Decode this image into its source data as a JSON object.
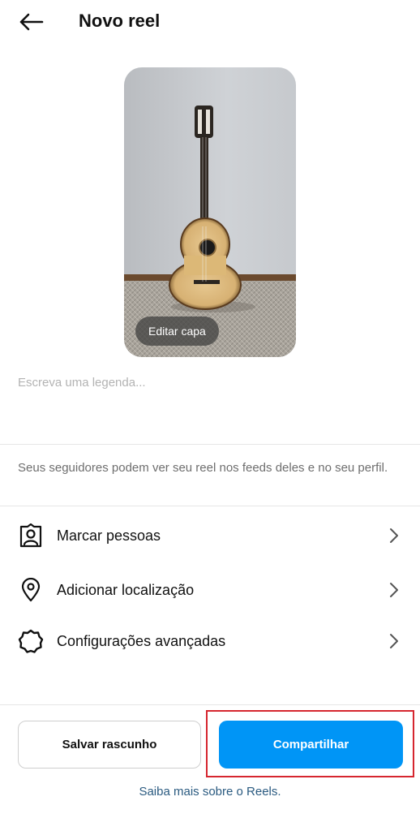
{
  "header": {
    "title": "Novo reel",
    "back_icon": "arrow-left-icon"
  },
  "cover": {
    "edit_label": "Editar capa"
  },
  "caption": {
    "placeholder": "Escreva uma legenda...",
    "value": ""
  },
  "info_text": "Seus seguidores podem ver seu reel nos feeds deles e no seu perfil.",
  "menu": {
    "items": [
      {
        "label": "Marcar pessoas",
        "icon": "tag-person-icon"
      },
      {
        "label": "Adicionar localização",
        "icon": "location-pin-icon"
      },
      {
        "label": "Configurações avançadas",
        "icon": "settings-gear-icon"
      }
    ]
  },
  "actions": {
    "draft_label": "Salvar rascunho",
    "share_label": "Compartilhar",
    "learn_more": "Saiba mais sobre o Reels."
  },
  "colors": {
    "primary": "#0095f6",
    "highlight": "#d6262f",
    "link": "#2a5a80"
  }
}
